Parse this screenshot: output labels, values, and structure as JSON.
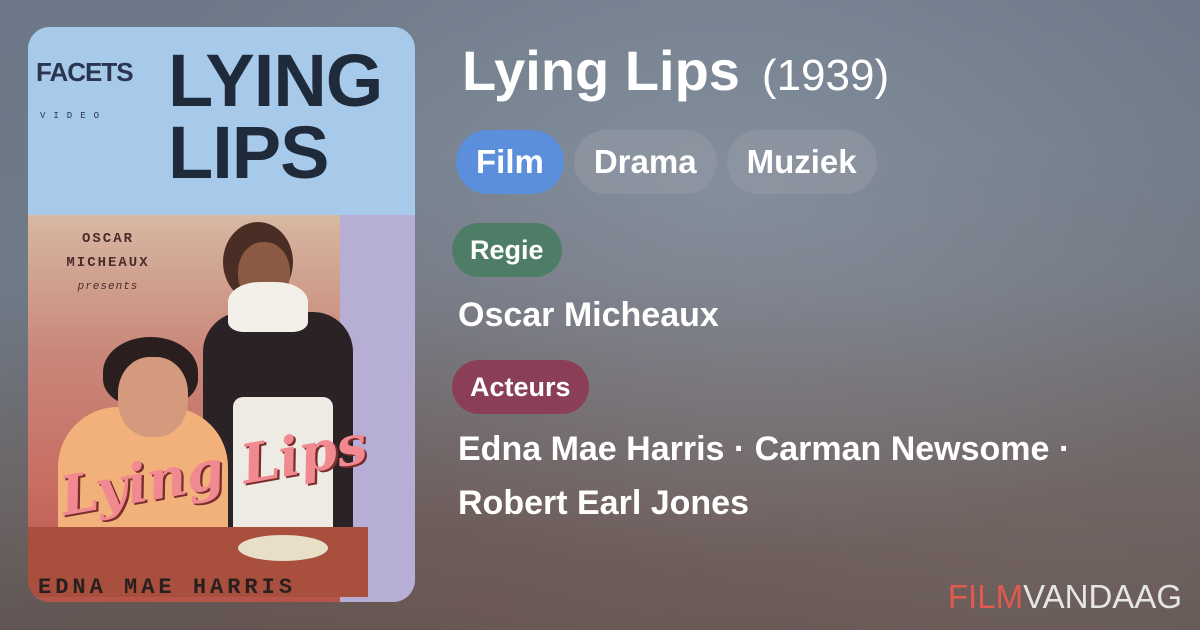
{
  "poster": {
    "logo": "FACETS",
    "logo_sub": "VIDEO",
    "title": "LYING LIPS",
    "presents_line1": "OSCAR",
    "presents_line2": "MICHEAUX",
    "presents_line3": "presents",
    "script_title": "Lying Lips",
    "bottom_text": "EDNA MAE HARRIS"
  },
  "movie": {
    "title": "Lying Lips",
    "year": "(1939)"
  },
  "genres": [
    {
      "label": "Film",
      "active": true
    },
    {
      "label": "Drama",
      "active": false
    },
    {
      "label": "Muziek",
      "active": false
    }
  ],
  "credits": {
    "director_label": "Regie",
    "director": "Oscar Micheaux",
    "actors_label": "Acteurs",
    "actors_line1": "Edna Mae Harris · Carman Newsome ·",
    "actors_line2": "Robert Earl Jones"
  },
  "brand": {
    "part1": "FILM",
    "part2": "VANDAAG"
  },
  "colors": {
    "active_genre": "#5b8edb",
    "regie_badge": "#4e7d67",
    "acteurs_badge": "#8b3f57",
    "brand_accent": "#e05a4e"
  }
}
